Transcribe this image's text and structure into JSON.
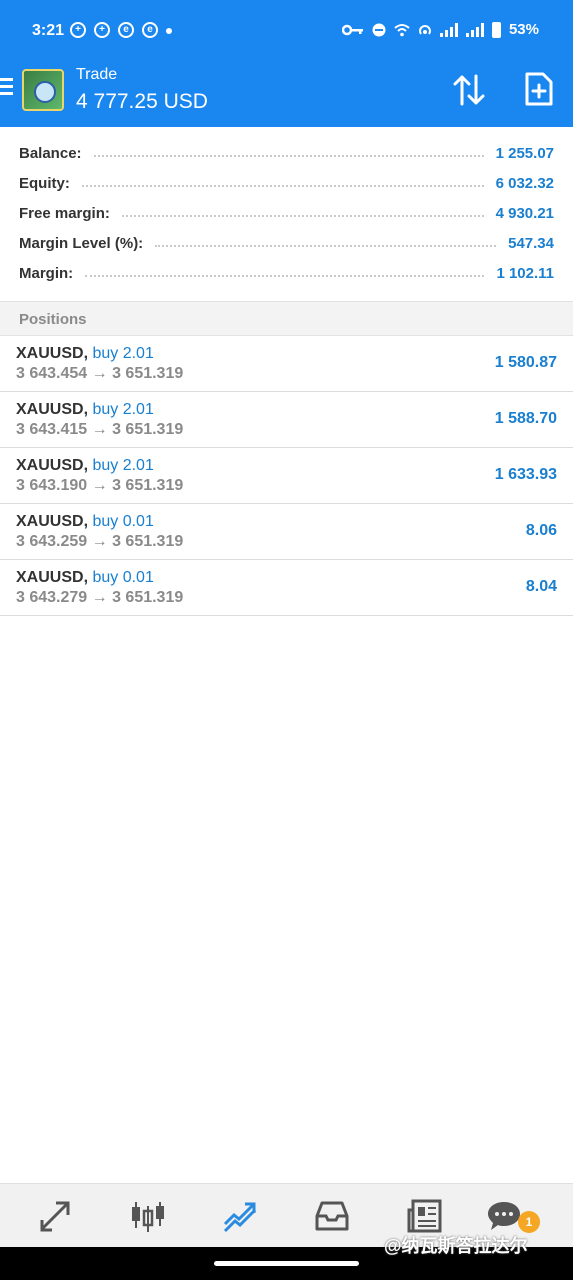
{
  "status_bar": {
    "time": "3:21",
    "battery": "53%"
  },
  "header": {
    "title": "Trade",
    "amount": "4 777.25 USD"
  },
  "summary": [
    {
      "label": "Balance:",
      "value": "1 255.07"
    },
    {
      "label": "Equity:",
      "value": "6 032.32"
    },
    {
      "label": "Free margin:",
      "value": "4 930.21"
    },
    {
      "label": "Margin Level (%):",
      "value": "547.34"
    },
    {
      "label": "Margin:",
      "value": "1 102.11"
    }
  ],
  "positions_title": "Positions",
  "positions": [
    {
      "symbol": "XAUUSD,",
      "type": "buy 2.01",
      "prices": "3 643.454 → 3 651.319",
      "profit": "1 580.87"
    },
    {
      "symbol": "XAUUSD,",
      "type": "buy 2.01",
      "prices": "3 643.415 → 3 651.319",
      "profit": "1 588.70"
    },
    {
      "symbol": "XAUUSD,",
      "type": "buy 2.01",
      "prices": "3 643.190 → 3 651.319",
      "profit": "1 633.93"
    },
    {
      "symbol": "XAUUSD,",
      "type": "buy 0.01",
      "prices": "3 643.259 → 3 651.319",
      "profit": "8.06"
    },
    {
      "symbol": "XAUUSD,",
      "type": "buy 0.01",
      "prices": "3 643.279 → 3 651.319",
      "profit": "8.04"
    }
  ],
  "nav": {
    "items": [
      "quotes-icon",
      "chart-icon",
      "trade-icon",
      "history-icon",
      "news-icon",
      "messages-icon"
    ],
    "active": "trade-icon",
    "messages_badge": "1"
  },
  "watermark": "@纳瓦斯答拉达尔",
  "colors": {
    "header": "#1a87f0",
    "value_blue": "#1a7fcf",
    "badge": "#f5a623"
  }
}
